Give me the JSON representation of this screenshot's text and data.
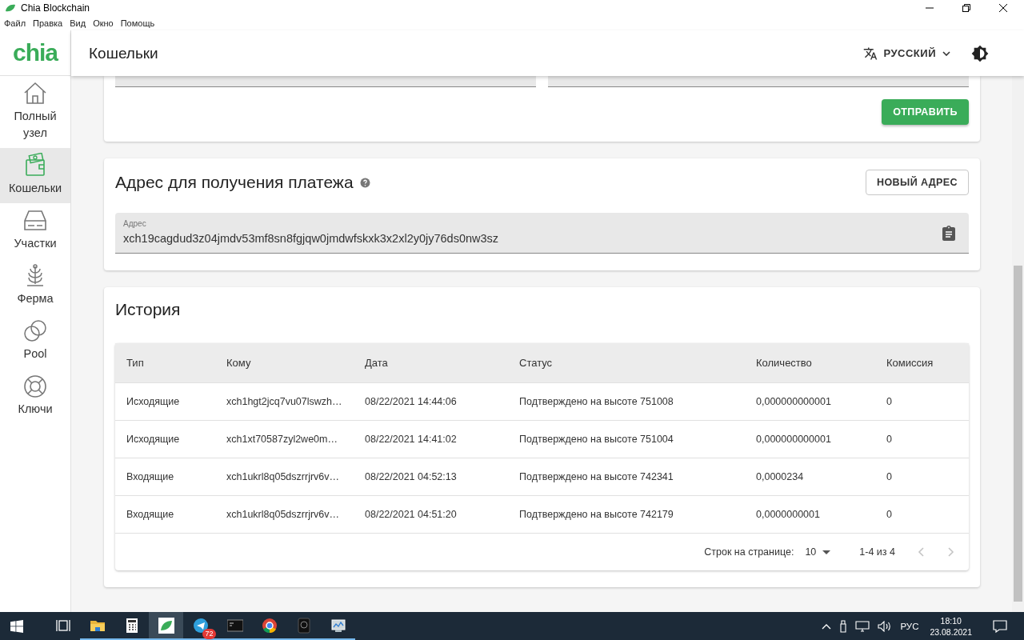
{
  "window": {
    "title": "Chia Blockchain"
  },
  "menu": [
    "Файл",
    "Правка",
    "Вид",
    "Окно",
    "Помощь"
  ],
  "logo": "chia",
  "header": {
    "title": "Кошельки",
    "language": "РУССКИЙ"
  },
  "sidebar": {
    "items": [
      {
        "label": "Полный узел",
        "kind": "house",
        "selected": false
      },
      {
        "label": "Кошельки",
        "kind": "wallet",
        "selected": true
      },
      {
        "label": "Участки",
        "kind": "drive",
        "selected": false
      },
      {
        "label": "Ферма",
        "kind": "plant",
        "selected": false
      },
      {
        "label": "Pool",
        "kind": "circles",
        "selected": false
      },
      {
        "label": "Ключи",
        "kind": "ring",
        "selected": false
      }
    ]
  },
  "send_card": {
    "button": "ОТПРАВИТЬ"
  },
  "receive_card": {
    "title": "Адрес для получения платежа",
    "button": "НОВЫЙ АДРЕС",
    "address_label": "Адрес",
    "address": "xch19cagdud3z04jmdv53mf8sn8fgjqw0jmdwfskxk3x2xl2y0jy76ds0nw3sz"
  },
  "history": {
    "title": "История",
    "columns": [
      "Тип",
      "Кому",
      "Дата",
      "Статус",
      "Количество",
      "Комиссия"
    ],
    "rows": [
      [
        "Исходящие",
        "xch1hgt2jcq7vu07lswzh…",
        "08/22/2021 14:44:06",
        "Подтверждено на высоте 751008",
        "0,000000000001",
        "0"
      ],
      [
        "Исходящие",
        "xch1xt70587zyl2we0m…",
        "08/22/2021 14:41:02",
        "Подтверждено на высоте 751004",
        "0,000000000001",
        "0"
      ],
      [
        "Входящие",
        "xch1ukrl8q05dszrrjrv6v…",
        "08/22/2021 04:52:13",
        "Подтверждено на высоте 742341",
        "0,0000234",
        "0"
      ],
      [
        "Входящие",
        "xch1ukrl8q05dszrrjrv6v…",
        "08/22/2021 04:51:20",
        "Подтверждено на высоте 742179",
        "0,0000000001",
        "0"
      ]
    ],
    "pagination": {
      "rows_label": "Строк на странице:",
      "rows_value": "10",
      "range": "1-4 из 4",
      "prev_disabled": true,
      "next_disabled": true
    }
  },
  "taskbar": {
    "apps": [
      {
        "kind": "taskview",
        "active": false
      },
      {
        "kind": "folder",
        "active": false
      },
      {
        "kind": "calculator",
        "active": false
      },
      {
        "kind": "leaf",
        "active": true
      },
      {
        "kind": "telegram",
        "active": false,
        "badge": "72"
      },
      {
        "kind": "terminal",
        "active": false
      },
      {
        "kind": "chrome",
        "active": false
      },
      {
        "kind": "drive",
        "active": false
      },
      {
        "kind": "monitor",
        "active": false
      }
    ],
    "language": "РУС",
    "time": "18:10",
    "date": "23.08.2021"
  }
}
